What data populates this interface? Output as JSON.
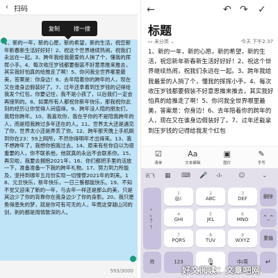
{
  "left": {
    "header_title": "扫码",
    "back_icon": "back-arrow-icon",
    "popup": {
      "copy_label": "复制",
      "search_label": "搜一搜"
    },
    "text": "1、新的一年，新的心愿，新的希望，新的生活，祝您新年新春新生活好好好！2、祝这个世界继续热闹，祝我们永远在一起。3、跨年我给我最爱的人捎了个，懂我的挥挥小手。4、每次收压岁钱都要假装不好意思推来推去，其实我好怕真的给推走了啊！5、你问我全世界哪里最美，答案是：你身边！6、去年陪着你的跨年的人，现在又在谁身边假装好了。7、过年还拿着到压岁钱的记得给我发个红包，你要记住，我不是小孩了，以后我们一定会再接到的。8、如果所有人都祝你新年快乐，那我祝你此刻的经历让你觉得人间值得。9、跨年没人陪的朋友们，我陪你跨年。10、我喜欢你，我在乎你的不是陪我跨年的人，而是陪我跨过多年还在的人。11、世界太大还是遇见了你，世界太小还是弄丢了你。12、跨年那天晚上手机刷到你在23：59上网所，不然你得明年才出得来。13、我不想跨年了，我想你抱我过去。14、原来有些你自以为很重要的人，你不联系他，他就真的永远不会联系你。15、再见啦，我要去拥抱2021年，16、你们都把手里的活放一下，准备准备一下我的跨年礼物。17、努力到力所能及，坚持到哪年五月份实现一切憧憬2021年的到来。18、元旦快乐，新年快乐，一日三餐都能快乐。19、不知不觉又迎来了新的一年，与去年一样还是那么的美，只是其边少了你的背靠你在我身边少了你的身影。20、我只愿鱼得患失的梦，就是你可有可无的人，毕竟这穿越山河的剑，刺的都是用情致深的人。",
    "counter": "593/3000"
  },
  "right": {
    "back_icon": "back-arrow-icon",
    "undo_icon": "undo-icon",
    "redo_icon": "redo-icon",
    "check_icon": "check-icon",
    "title": "标题",
    "category": "未分类",
    "category_icon": "note-icon",
    "chevron_icon": "chevron-down-icon",
    "time": "今天 下午2:37",
    "text": "1、新的一年，新的心愿，新的希望，新的生活，祝您新年新春新生活好好好！2、祝这个世界继续热闹，祝我们永远在一起。3、跨年我给我最爱的人捎了个，懂我的挥挥小手。4、每次收压岁钱都要假装不好意思推来推去，其实我好怕真的给推走了啊！5、你问我全世界哪里最美，答案是：你身边！6、去年陪着你的跨年的人，现在又在谁身边假装好了。7、过年还能拿到压岁钱的记得给我发个红包",
    "toolbar": [
      {
        "icon": "checklist-icon",
        "glyph": "☑",
        "label": "清单"
      },
      {
        "icon": "text-format-icon",
        "glyph": "Aa",
        "label": "文本编辑"
      },
      {
        "icon": "image-icon",
        "glyph": "▣",
        "label": "图片"
      },
      {
        "icon": "handwriting-icon",
        "glyph": "✎",
        "label": "手写"
      }
    ]
  },
  "keyboard": {
    "top_bar": [
      {
        "icon": "ifly-logo-icon",
        "glyph": "讯飞"
      },
      {
        "icon": "grid-icon",
        "glyph": "▦"
      },
      {
        "icon": "keyboard-icon",
        "glyph": "⌨"
      },
      {
        "icon": "mic-icon",
        "glyph": "🎤"
      },
      {
        "icon": "cursor-icon",
        "glyph": "‹I›"
      },
      {
        "icon": "emoji-icon",
        "glyph": "☺"
      },
      {
        "icon": "collapse-icon",
        "glyph": "⌄"
      }
    ],
    "side_keys": [
      "，",
      "。",
      "？",
      "！"
    ],
    "rows": [
      [
        {
          "n": "1",
          "t": "@/."
        },
        {
          "n": "2",
          "t": "ABC"
        },
        {
          "n": "3",
          "t": "DEF"
        }
      ],
      [
        {
          "n": "4",
          "t": "GHI"
        },
        {
          "n": "5",
          "t": "JKL"
        },
        {
          "n": "6",
          "t": "MNO"
        }
      ],
      [
        {
          "n": "7",
          "t": "PQRS"
        },
        {
          "n": "8",
          "t": "TUV"
        },
        {
          "n": "9",
          "t": "WXYZ"
        }
      ]
    ],
    "right_keys": [
      "删除",
      "^_^",
      "重输"
    ],
    "bottom": {
      "symbol": "符",
      "num": "123",
      "space_icon": "mic-icon",
      "space_glyph": "🎙",
      "lang": "中/英",
      "enter": "↵"
    }
  },
  "watermark": "好文阅读：文章吧网"
}
